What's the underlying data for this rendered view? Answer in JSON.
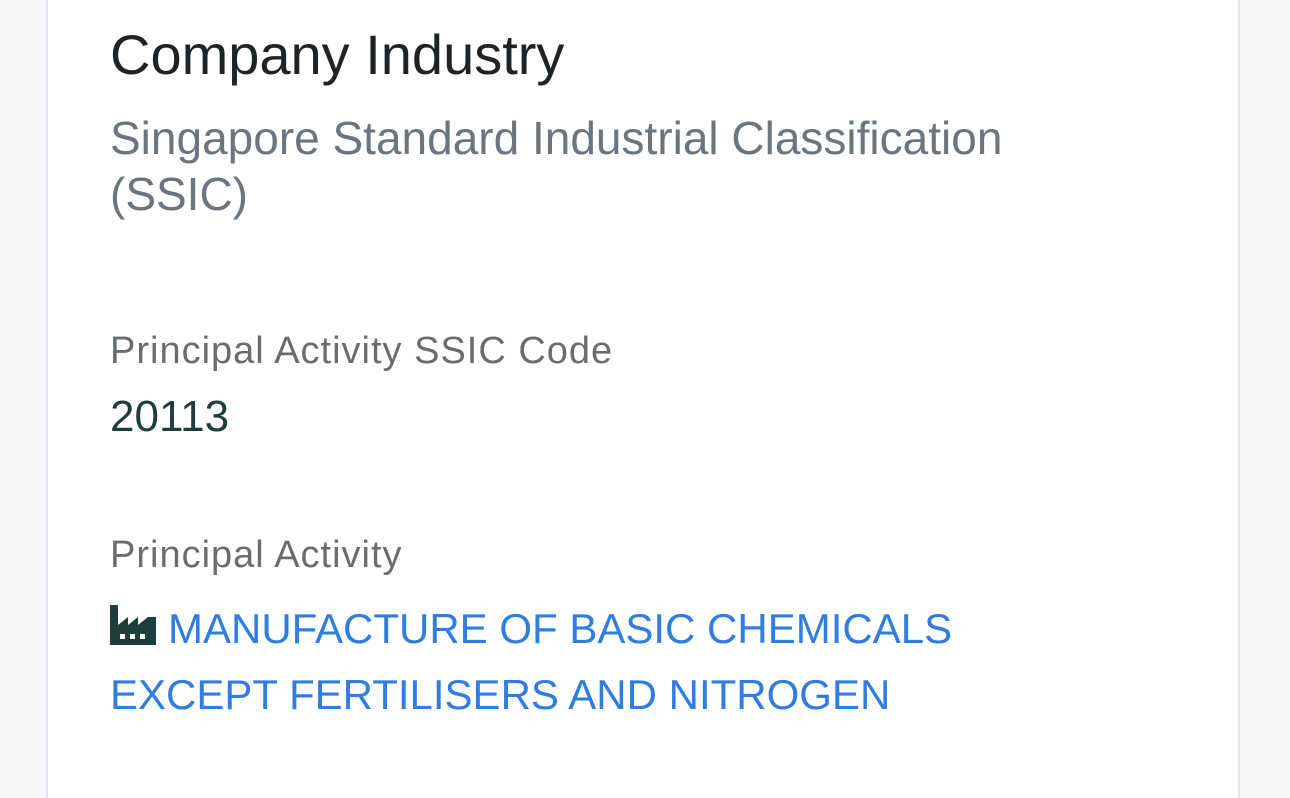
{
  "section": {
    "title": "Company Industry",
    "subtitle": "Singapore Standard Industrial Classification (SSIC)"
  },
  "fields": {
    "ssic_code": {
      "label": "Principal Activity SSIC Code",
      "value": "20113"
    },
    "principal_activity": {
      "label": "Principal Activity",
      "icon": "factory-icon",
      "value": "MANUFACTURE OF BASIC CHEMICALS EXCEPT FERTILISERS AND NITROGEN"
    }
  },
  "colors": {
    "link": "#2f7de1",
    "code_value": "#1f3d3a",
    "icon": "#1f3d3a"
  }
}
